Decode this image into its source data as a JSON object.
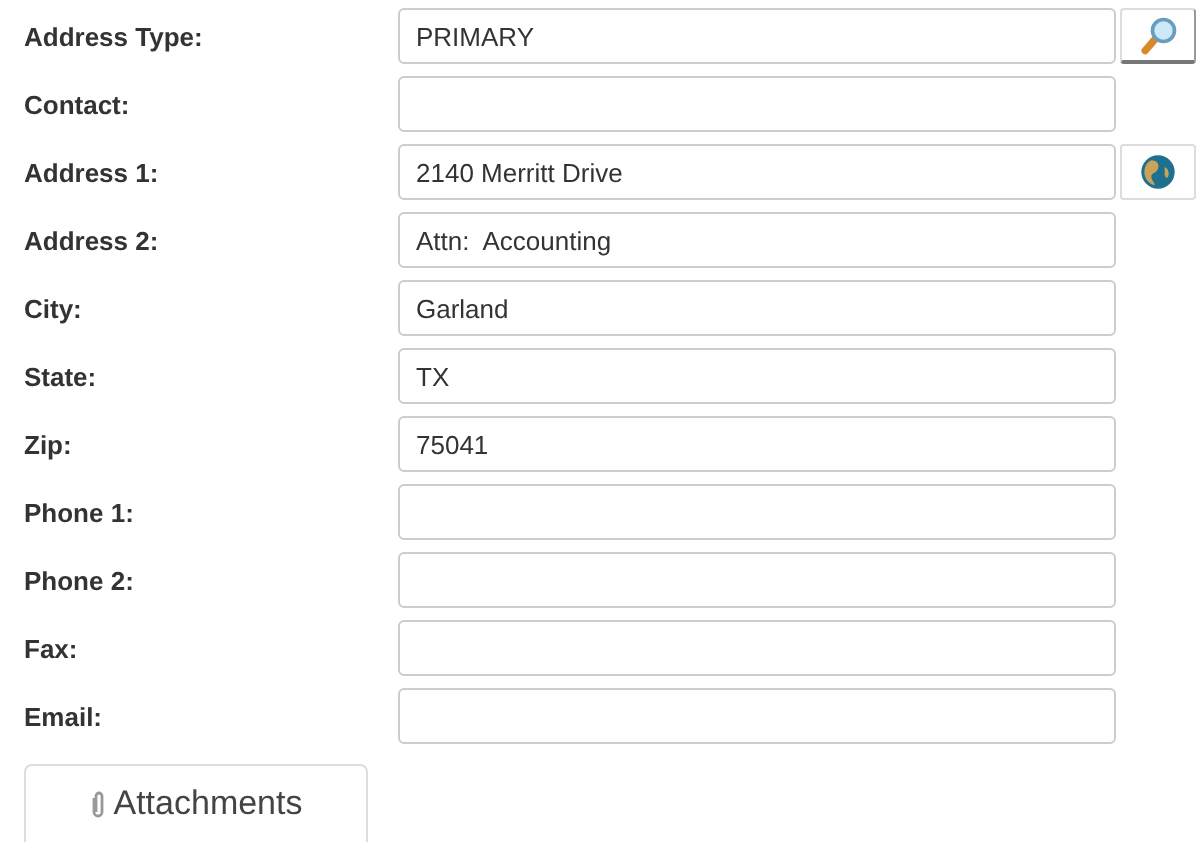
{
  "fields": [
    {
      "label": "Address Type:",
      "value": "PRIMARY",
      "kind": "lookup"
    },
    {
      "label": "Contact:",
      "kind": "plain"
    },
    {
      "label": "Address 1:",
      "value": "2140 Merritt Drive",
      "kind": "map"
    },
    {
      "label": "Address 2:",
      "value": "Attn:  Accounting",
      "kind": "plain"
    },
    {
      "label": "City:",
      "value": "Garland",
      "kind": "plain"
    },
    {
      "label": "State:",
      "value": "TX",
      "kind": "plain"
    },
    {
      "label": "Zip:",
      "value": "75041",
      "kind": "plain"
    },
    {
      "label": "Phone 1:",
      "kind": "plain"
    },
    {
      "label": "Phone 2:",
      "kind": "plain"
    },
    {
      "label": "Fax:",
      "kind": "plain"
    },
    {
      "label": "Email:",
      "kind": "plain"
    }
  ],
  "tabs": [
    {
      "label": "Attachments"
    }
  ]
}
